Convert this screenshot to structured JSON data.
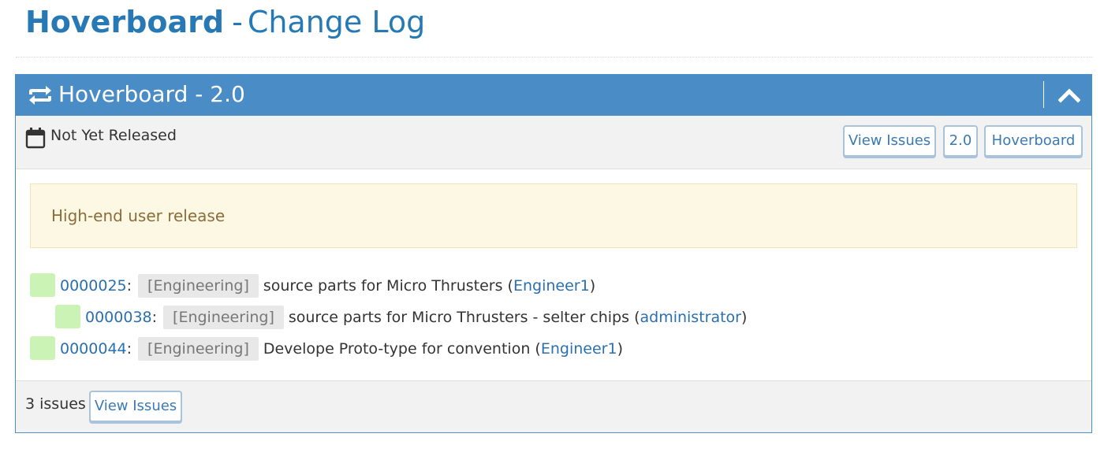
{
  "page": {
    "brand": "Hoverboard",
    "separator": "-",
    "subtitle": "Change Log"
  },
  "version_widget": {
    "title": "Hoverboard - 2.0",
    "header_icon": "repeat-icon",
    "collapse_icon": "chevron-up-icon",
    "status_icon": "calendar-icon",
    "status": "Not Yet Released",
    "buttons": {
      "view_issues": "View Issues",
      "version": "2.0",
      "project": "Hoverboard"
    },
    "description": "High-end user release",
    "issues": [
      {
        "id": "0000025",
        "colon": ":",
        "category": "[Engineering]",
        "summary": "source parts for Micro Thrusters",
        "open_paren": "(",
        "assignee": "Engineer1",
        "close_paren": ")"
      },
      {
        "id": "0000038",
        "colon": ":",
        "category": "[Engineering]",
        "summary": "source parts for Micro Thrusters - selter chips",
        "open_paren": "(",
        "assignee": "administrator",
        "close_paren": ")"
      },
      {
        "id": "0000044",
        "colon": ":",
        "category": "[Engineering]",
        "summary": "Develope Proto-type for convention",
        "open_paren": "(",
        "assignee": "Engineer1",
        "close_paren": ")"
      }
    ],
    "footer": {
      "count": "3 issues",
      "view_issues": "View Issues"
    }
  },
  "colors": {
    "brand_blue": "#2679b5",
    "widget_header": "#4a8dc6",
    "status_swatch": "#cbf3b6",
    "alert_bg": "#fcf8e3",
    "alert_text": "#8a6d3b",
    "link": "#2a6fb0"
  }
}
